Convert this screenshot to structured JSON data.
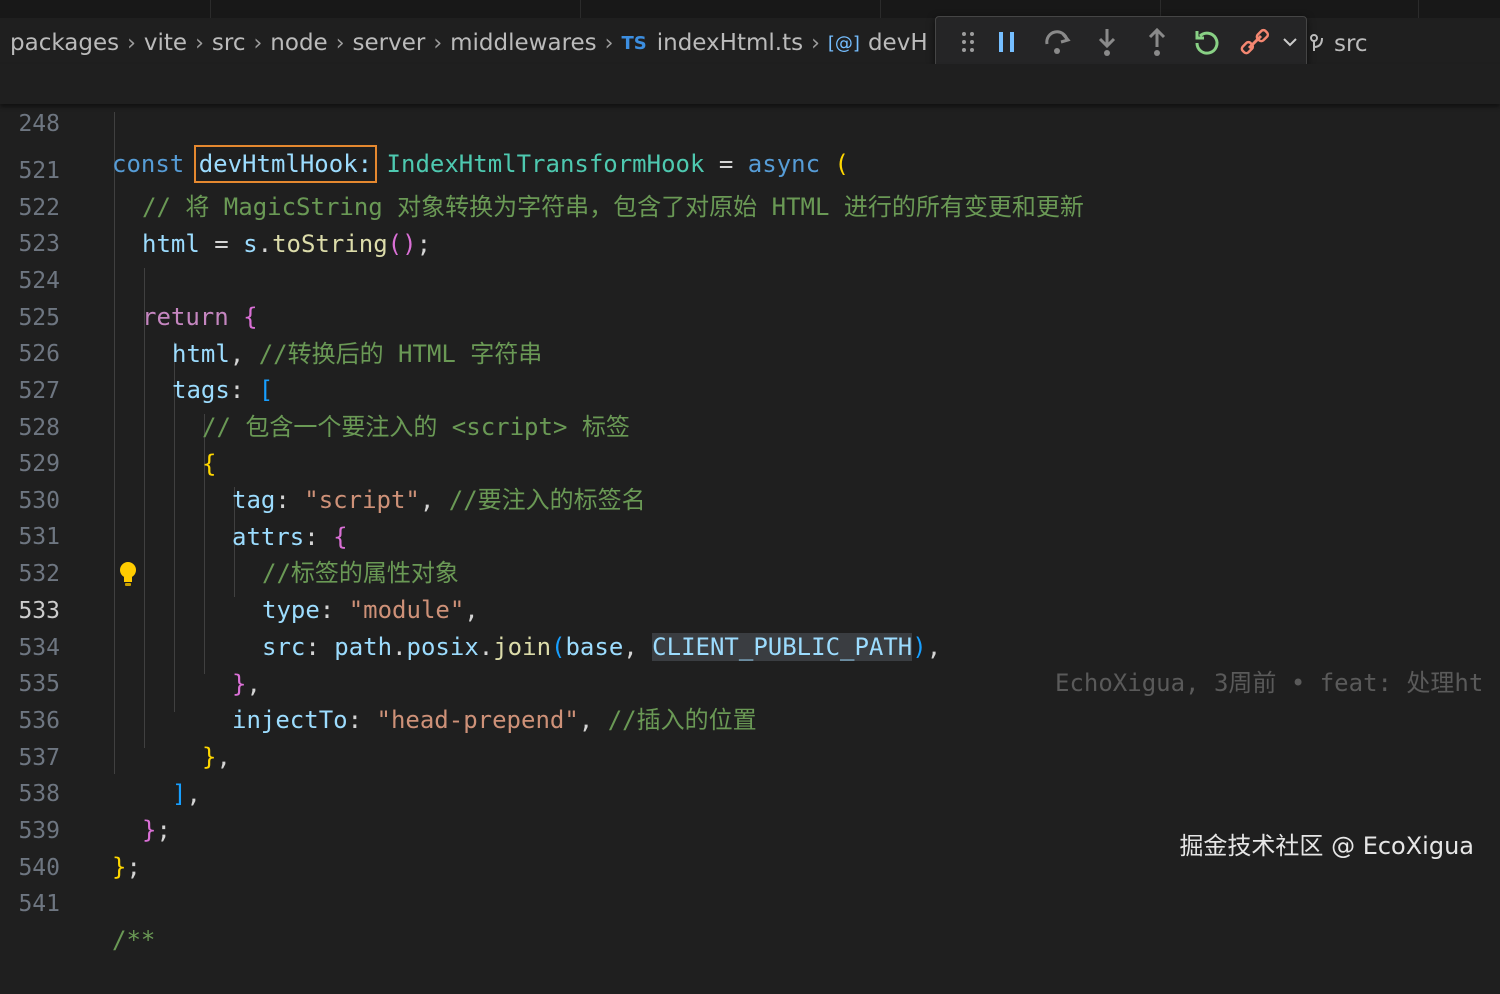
{
  "breadcrumb": {
    "items": [
      "packages",
      "vite",
      "src",
      "node",
      "server",
      "middlewares",
      "indexHtml.ts",
      "devH"
    ],
    "file_badge": "TS",
    "symbol_badge": "[@]"
  },
  "debug_toolbar": {
    "buttons": [
      "pause",
      "step-over",
      "step-into",
      "step-out",
      "restart",
      "disconnect"
    ],
    "dropdown": "v",
    "trail_text": "src"
  },
  "sticky": {
    "line_number": "248",
    "tokens": [
      "const",
      "devHtmlHook:",
      "IndexHtmlTransformHook",
      "=",
      "async",
      "("
    ]
  },
  "editor": {
    "active_line": "533",
    "lines": [
      {
        "n": "521",
        "text": "// 将 MagicString 对象转换为字符串，包含了对原始 HTML 进行的所有变更和更新"
      },
      {
        "n": "522",
        "text": "html = s.toString();"
      },
      {
        "n": "523",
        "text": ""
      },
      {
        "n": "524",
        "text": "return {"
      },
      {
        "n": "525",
        "text": "html, //转换后的 HTML 字符串"
      },
      {
        "n": "526",
        "text": "tags: ["
      },
      {
        "n": "527",
        "text": "// 包含一个要注入的 <script> 标签"
      },
      {
        "n": "528",
        "text": "{"
      },
      {
        "n": "529",
        "text": "tag: \"script\", //要注入的标签名"
      },
      {
        "n": "530",
        "text": "attrs: {"
      },
      {
        "n": "531",
        "text": "//标签的属性对象"
      },
      {
        "n": "532",
        "text": "type: \"module\","
      },
      {
        "n": "533",
        "text": "src: path.posix.join(base, CLIENT_PUBLIC_PATH),"
      },
      {
        "n": "534",
        "text": "},"
      },
      {
        "n": "535",
        "text": "injectTo: \"head-prepend\", //插入的位置"
      },
      {
        "n": "536",
        "text": "},"
      },
      {
        "n": "537",
        "text": "],"
      },
      {
        "n": "538",
        "text": "};"
      },
      {
        "n": "539",
        "text": "};"
      },
      {
        "n": "540",
        "text": ""
      },
      {
        "n": "541",
        "text": "/**"
      }
    ],
    "blame": "EchoXigua, 3周前 • feat: 处理ht"
  },
  "watermark": "掘金技术社区 @ EcoXigua",
  "colors": {
    "background": "#1f1f1f",
    "keyword": "#569cd6",
    "control": "#c586c0",
    "variable": "#9cdcfe",
    "type": "#4ec9b0",
    "function": "#dcdcaa",
    "string": "#ce9178",
    "comment": "#6a9955",
    "highlight_box": "#e5882f"
  }
}
